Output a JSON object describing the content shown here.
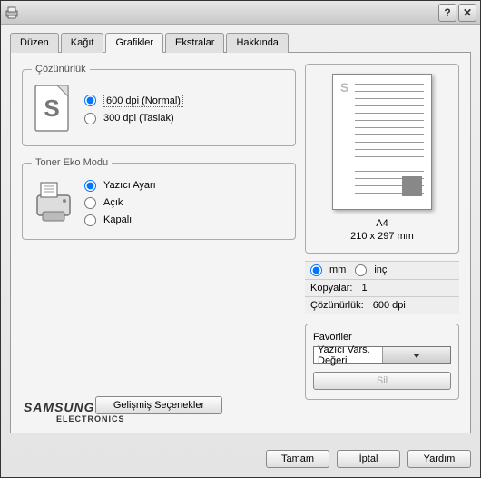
{
  "titlebar": {
    "help_label": "?",
    "close_label": "✕"
  },
  "tabs": {
    "layout": "Düzen",
    "paper": "Kağıt",
    "graphics": "Grafikler",
    "extras": "Ekstralar",
    "about": "Hakkında"
  },
  "resolution": {
    "legend": "Çözünürlük",
    "opt_600": "600 dpi (Normal)",
    "opt_300": "300 dpi (Taslak)"
  },
  "toner": {
    "legend": "Toner Eko Modu",
    "opt_printer": "Yazıcı Ayarı",
    "opt_on": "Açık",
    "opt_off": "Kapalı"
  },
  "advanced_btn": "Gelişmiş Seçenekler",
  "logo": {
    "brand": "SAMSUNG",
    "sub": "ELECTRONICS"
  },
  "preview": {
    "paper_name": "A4",
    "paper_dim": "210 x 297 mm",
    "s_mark": "S"
  },
  "units": {
    "mm": "mm",
    "inch": "inç"
  },
  "info": {
    "copies_label": "Kopyalar:",
    "copies_value": "1",
    "res_label": "Çözünürlük:",
    "res_value": "600 dpi"
  },
  "favorites": {
    "legend": "Favoriler",
    "selected": "Yazıcı Vars. Değeri",
    "delete": "Sil"
  },
  "buttons": {
    "ok": "Tamam",
    "cancel": "İptal",
    "help": "Yardım"
  }
}
